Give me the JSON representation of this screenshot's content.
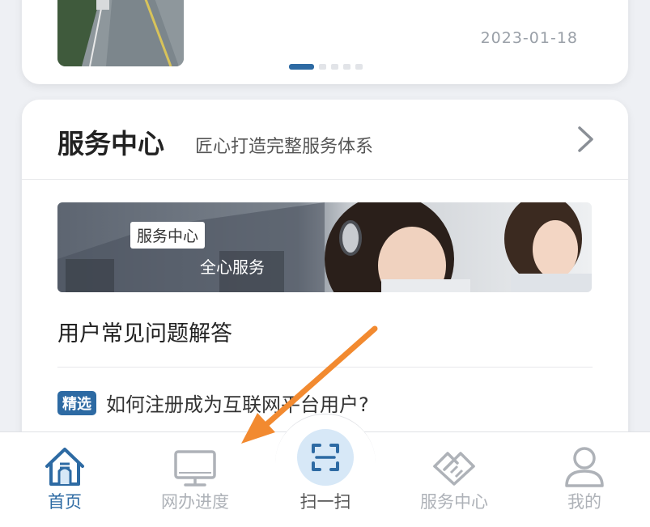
{
  "news": {
    "date": "2023-01-18",
    "carousel_total": 5,
    "carousel_active": 1
  },
  "service_center": {
    "title": "服务中心",
    "subtitle": "匠心打造完整服务体系",
    "banner": {
      "tag": "服务中心",
      "subtitle": "全心服务"
    },
    "faq_heading": "用户常见问题解答",
    "faq_items": [
      {
        "badge": "精选",
        "text": "如何注册成为互联网平台用户?"
      }
    ]
  },
  "bottom_nav": {
    "items": [
      {
        "label": "首页",
        "icon": "home-icon",
        "active": true
      },
      {
        "label": "网办进度",
        "icon": "monitor-icon",
        "active": false
      },
      {
        "label": "扫一扫",
        "icon": "scan-icon",
        "active": false
      },
      {
        "label": "服务中心",
        "icon": "handshake-icon",
        "active": false
      },
      {
        "label": "我的",
        "icon": "user-icon",
        "active": false
      }
    ]
  },
  "colors": {
    "accent": "#2d6aa3",
    "inactive": "#aeb2b8",
    "annotation_arrow": "#f28a30"
  }
}
